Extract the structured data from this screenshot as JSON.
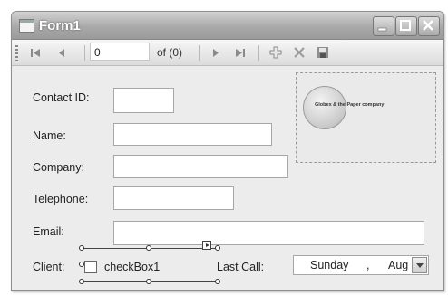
{
  "window": {
    "title": "Form1"
  },
  "navigator": {
    "position_value": "0",
    "count_text": "of (0)"
  },
  "form": {
    "contact_id_label": "Contact ID:",
    "name_label": "Name:",
    "company_label": "Company:",
    "telephone_label": "Telephone:",
    "email_label": "Email:",
    "client_label": "Client:",
    "checkbox_label": "checkBox1",
    "last_call_label": "Last Call:",
    "last_call_day": "Sunday",
    "last_call_sep": ",",
    "last_call_month": "Aug"
  },
  "picture": {
    "caption": "Globex & the Paper company"
  },
  "icons": [
    "app-form-icon",
    "minimize-icon",
    "maximize-icon",
    "close-icon",
    "move-first-icon",
    "move-previous-icon",
    "move-next-icon",
    "move-last-icon",
    "add-new-icon",
    "delete-icon",
    "save-icon",
    "smart-tag-icon",
    "dropdown-arrow-icon"
  ]
}
